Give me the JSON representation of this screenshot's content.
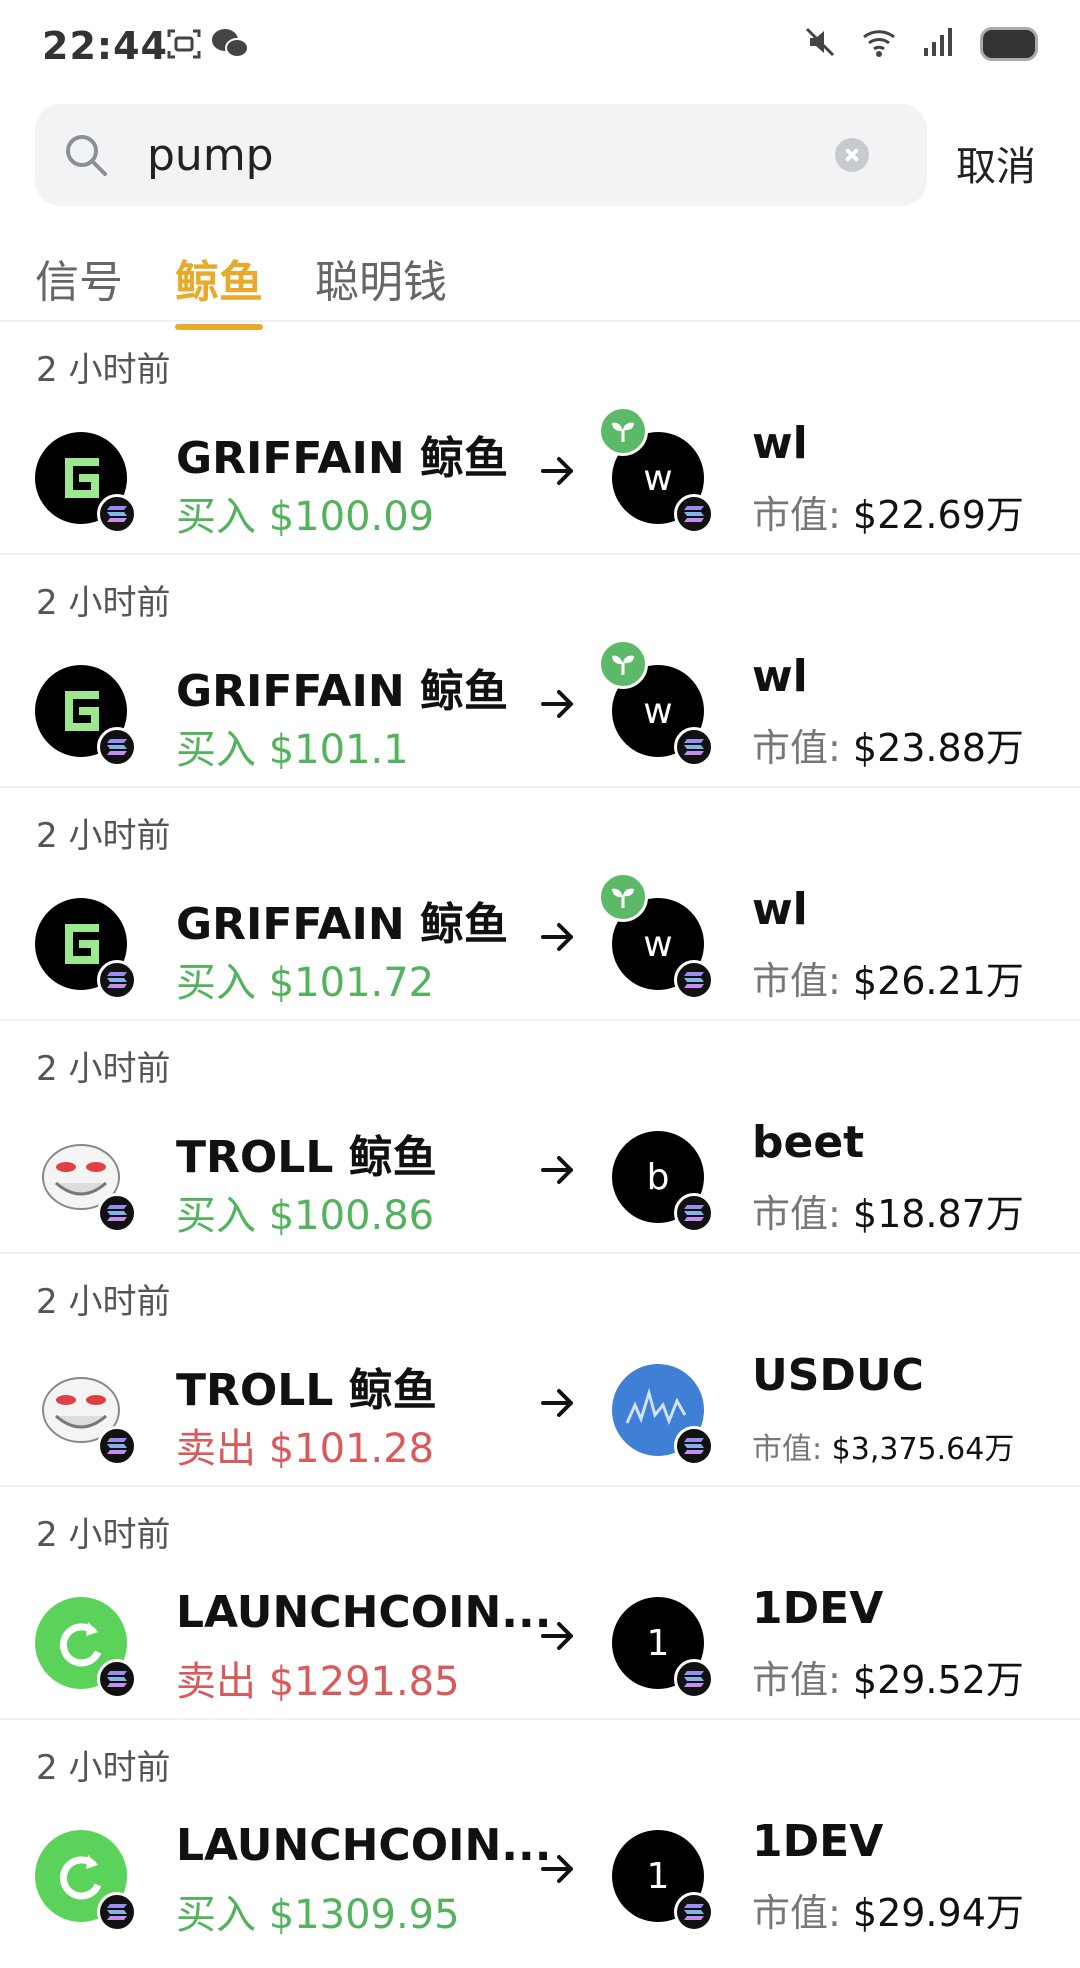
{
  "status_bar": {
    "time": "22:44"
  },
  "search": {
    "value": "pump",
    "cancel_label": "取消"
  },
  "tabs": [
    {
      "label": "信号",
      "active": false
    },
    {
      "label": "鲸鱼",
      "active": true
    },
    {
      "label": "聪明钱",
      "active": false
    }
  ],
  "colors": {
    "accent": "#e9a92a",
    "buy": "#52b35c",
    "sell": "#d85a5a"
  },
  "feed": [
    {
      "time": "2 小时前",
      "whale": "GRIFFAIN 鲸鱼",
      "action": "买入",
      "amount": "$100.09",
      "type": "buy",
      "whale_icon": "griffain-icon",
      "token": "wl",
      "token_letter": "w",
      "is_new": true,
      "mcap_label": "市值:",
      "mcap": "$22.69万"
    },
    {
      "time": "2 小时前",
      "whale": "GRIFFAIN 鲸鱼",
      "action": "买入",
      "amount": "$101.1",
      "type": "buy",
      "whale_icon": "griffain-icon",
      "token": "wl",
      "token_letter": "w",
      "is_new": true,
      "mcap_label": "市值:",
      "mcap": "$23.88万"
    },
    {
      "time": "2 小时前",
      "whale": "GRIFFAIN 鲸鱼",
      "action": "买入",
      "amount": "$101.72",
      "type": "buy",
      "whale_icon": "griffain-icon",
      "token": "wl",
      "token_letter": "w",
      "is_new": true,
      "mcap_label": "市值:",
      "mcap": "$26.21万"
    },
    {
      "time": "2 小时前",
      "whale": "TROLL 鲸鱼",
      "action": "买入",
      "amount": "$100.86",
      "type": "buy",
      "whale_icon": "troll-face-icon",
      "token": "beet",
      "token_letter": "b",
      "is_new": false,
      "mcap_label": "市值:",
      "mcap": "$18.87万"
    },
    {
      "time": "2 小时前",
      "whale": "TROLL 鲸鱼",
      "action": "卖出",
      "amount": "$101.28",
      "type": "sell",
      "whale_icon": "troll-face-icon",
      "token": "USDUC",
      "token_letter": "",
      "is_new": false,
      "mcap_label": "市值:",
      "mcap": "$3,375.64万"
    },
    {
      "time": "2 小时前",
      "whale": "LAUNCHCOIN...",
      "action": "卖出",
      "amount": "$1291.85",
      "type": "sell",
      "whale_icon": "launchcoin-icon",
      "token": "1DEV",
      "token_letter": "1",
      "is_new": false,
      "mcap_label": "市值:",
      "mcap": "$29.52万"
    },
    {
      "time": "2 小时前",
      "whale": "LAUNCHCOIN...",
      "action": "买入",
      "amount": "$1309.95",
      "type": "buy",
      "whale_icon": "launchcoin-icon",
      "token": "1DEV",
      "token_letter": "1",
      "is_new": false,
      "mcap_label": "市值:",
      "mcap": "$29.94万"
    }
  ]
}
